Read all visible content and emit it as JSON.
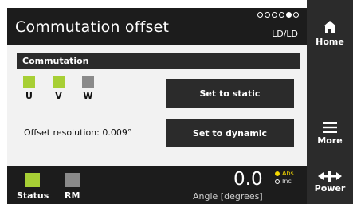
{
  "header": {
    "title": "Commutation offset",
    "mode": "LD/LD",
    "pager": {
      "total": 6,
      "active_index": 4
    }
  },
  "commutation": {
    "section_title": "Commutation",
    "phases": [
      {
        "label": "U",
        "color": "#a7cf35"
      },
      {
        "label": "V",
        "color": "#a7cf35"
      },
      {
        "label": "W",
        "color": "#8a8a8a"
      }
    ],
    "offset_resolution_label": "Offset resolution: 0.009°",
    "set_static_label": "Set to static",
    "set_dynamic_label": "Set to dynamic"
  },
  "footer": {
    "status_label": "Status",
    "status_color": "#a7cf35",
    "rm_label": "RM",
    "rm_color": "#8a8a8a",
    "value": "0.0",
    "unit_label": "Angle [degrees]",
    "abs_label": "Abs",
    "inc_label": "Inc"
  },
  "nav": {
    "home_label": "Home",
    "more_label": "More",
    "power_label": "Power"
  }
}
